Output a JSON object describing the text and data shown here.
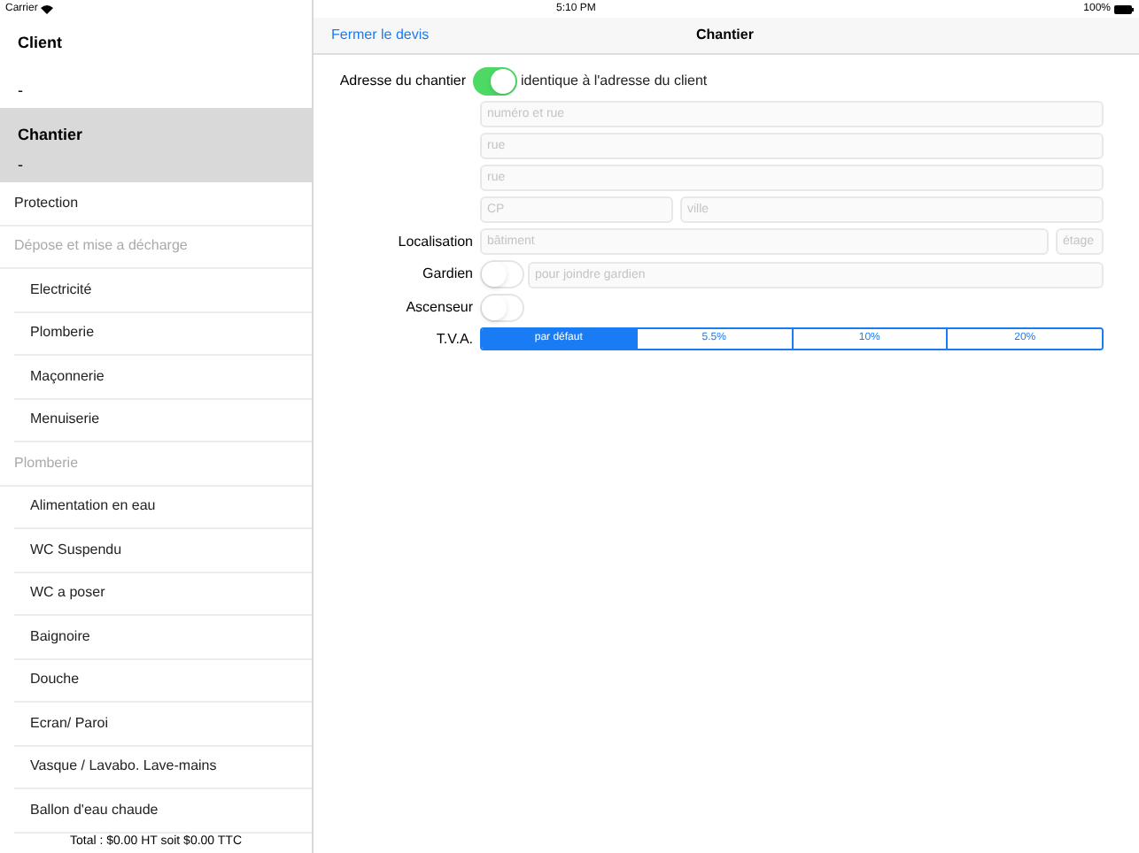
{
  "status_bar": {
    "carrier": "Carrier",
    "time": "5:10 PM",
    "battery": "100%"
  },
  "sidebar": {
    "entries": [
      {
        "title": "Client",
        "subtitle": "-",
        "selected": false
      },
      {
        "title": "Chantier",
        "subtitle": "-",
        "selected": true
      }
    ],
    "items": [
      {
        "kind": "top",
        "label": "Protection"
      },
      {
        "kind": "section",
        "label": "Dépose et mise a décharge"
      },
      {
        "kind": "item",
        "label": "Electricité"
      },
      {
        "kind": "item",
        "label": "Plomberie"
      },
      {
        "kind": "item",
        "label": "Maçonnerie"
      },
      {
        "kind": "item",
        "label": "Menuiserie"
      },
      {
        "kind": "section",
        "label": "Plomberie"
      },
      {
        "kind": "item",
        "label": "Alimentation en eau"
      },
      {
        "kind": "item",
        "label": "WC Suspendu"
      },
      {
        "kind": "item",
        "label": "WC a poser"
      },
      {
        "kind": "item",
        "label": "Baignoire"
      },
      {
        "kind": "item",
        "label": "Douche"
      },
      {
        "kind": "item",
        "label": "Ecran/ Paroi"
      },
      {
        "kind": "item",
        "label": "Vasque / Lavabo. Lave-mains"
      },
      {
        "kind": "item",
        "label": "Ballon d'eau chaude"
      }
    ],
    "total": "Total : $0.00 HT soit $0.00 TTC"
  },
  "nav": {
    "back": "Fermer le devis",
    "title": "Chantier"
  },
  "form": {
    "address": {
      "label": "Adresse du chantier",
      "on": true,
      "switch_label": "identique à l'adresse du client"
    },
    "street_fields": [
      {
        "placeholder": "numéro et rue"
      },
      {
        "placeholder": "rue"
      },
      {
        "placeholder": "rue"
      }
    ],
    "postcode": {
      "placeholder": "CP"
    },
    "city": {
      "placeholder": "ville"
    },
    "location": {
      "label": "Localisation",
      "building": {
        "placeholder": "bâtiment"
      },
      "floor": {
        "placeholder": "étage"
      }
    },
    "caretaker": {
      "label": "Gardien",
      "on": false,
      "field": {
        "placeholder": "pour joindre gardien"
      }
    },
    "elevator": {
      "label": "Ascenseur",
      "on": false
    },
    "vat": {
      "label": "T.V.A.",
      "options": [
        {
          "label": "par défaut",
          "selected": true
        },
        {
          "label": "5.5%",
          "selected": false
        },
        {
          "label": "10%",
          "selected": false
        },
        {
          "label": "20%",
          "selected": false
        }
      ]
    }
  }
}
